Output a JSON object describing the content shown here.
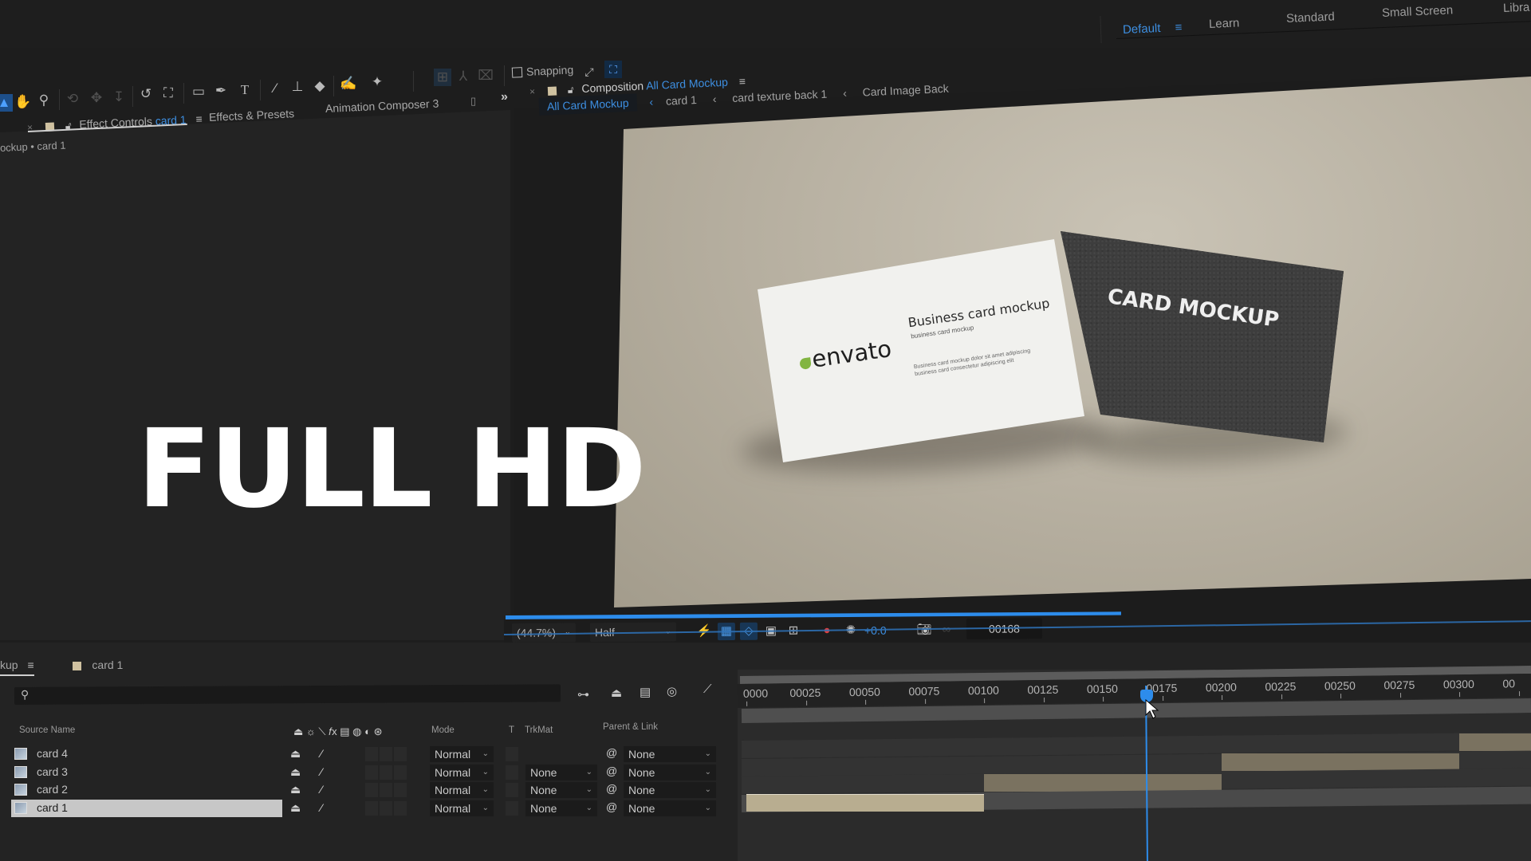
{
  "overlay_text": "FULL HD",
  "workspaces": {
    "items": [
      {
        "label": "Default",
        "active": true
      },
      {
        "label": "Learn",
        "active": false
      },
      {
        "label": "Standard",
        "active": false
      },
      {
        "label": "Small Screen",
        "active": false
      },
      {
        "label": "Libra",
        "active": false
      }
    ]
  },
  "toolbar": {
    "tools": [
      "selection-tool",
      "hand-tool",
      "zoom-tool",
      "orbit-tool",
      "pan-tool",
      "dolly-tool",
      "rotate-tool",
      "anchor-tool",
      "shape-tool",
      "pen-tool",
      "type-tool",
      "brush-tool",
      "clone-stamp-tool",
      "eraser-tool",
      "roto-brush-tool",
      "puppet-pin-tool"
    ],
    "snapping_label": "Snapping"
  },
  "left_panel": {
    "tabs": [
      {
        "label": "Effect Controls",
        "target": "card 1",
        "active": true
      },
      {
        "label": "Effects & Presets",
        "active": false
      },
      {
        "label": "Animation Composer 3",
        "active": false
      }
    ],
    "breadcrumb": "ockup • card 1"
  },
  "composition": {
    "panel_label": "Composition",
    "comp_name": "All Card Mockup",
    "breadcrumbs": [
      "All Card Mockup",
      "card 1",
      "card texture back 1",
      "Card Image Back"
    ],
    "preview": {
      "front_card": {
        "logo": "envato",
        "title": "Business card mockup",
        "subtitle": "business card mockup",
        "body_lines": [
          "Business card mockup dolor sit amet adipiscing",
          "business card consectetur adipiscing elit"
        ]
      },
      "back_card": {
        "title": "CARD MOCKUP"
      }
    },
    "viewer_bar": {
      "zoom": "(44.7%)",
      "resolution": "Half",
      "exposure": "+0.0",
      "current_time": "00168",
      "cache_progress": 0.6
    }
  },
  "timeline": {
    "comp_tab": "kup",
    "layer_tab": "card 1",
    "search_placeholder": "",
    "columns": {
      "source_name": "Source Name",
      "mode": "Mode",
      "t": "T",
      "trkmat": "TrkMat",
      "parent": "Parent & Link"
    },
    "layers": [
      {
        "name": "card 4",
        "mode": "Normal",
        "trkmat": "",
        "parent": "None",
        "selected": false,
        "in": 300,
        "out": 400
      },
      {
        "name": "card 3",
        "mode": "Normal",
        "trkmat": "None",
        "parent": "None",
        "selected": false,
        "in": 200,
        "out": 300
      },
      {
        "name": "card 2",
        "mode": "Normal",
        "trkmat": "None",
        "parent": "None",
        "selected": false,
        "in": 100,
        "out": 200
      },
      {
        "name": "card 1",
        "mode": "Normal",
        "trkmat": "None",
        "parent": "None",
        "selected": true,
        "in": 0,
        "out": 100
      }
    ],
    "ruler_ticks": [
      "0000",
      "00025",
      "00050",
      "00075",
      "00100",
      "00125",
      "00150",
      "00175",
      "00200",
      "00225",
      "00250",
      "00275",
      "00300",
      "00"
    ],
    "current_frame": 168,
    "colors": {
      "accent": "#2d8ceb",
      "layer_bar": "#7a7260",
      "selected_bar": "#b8ad90"
    }
  }
}
